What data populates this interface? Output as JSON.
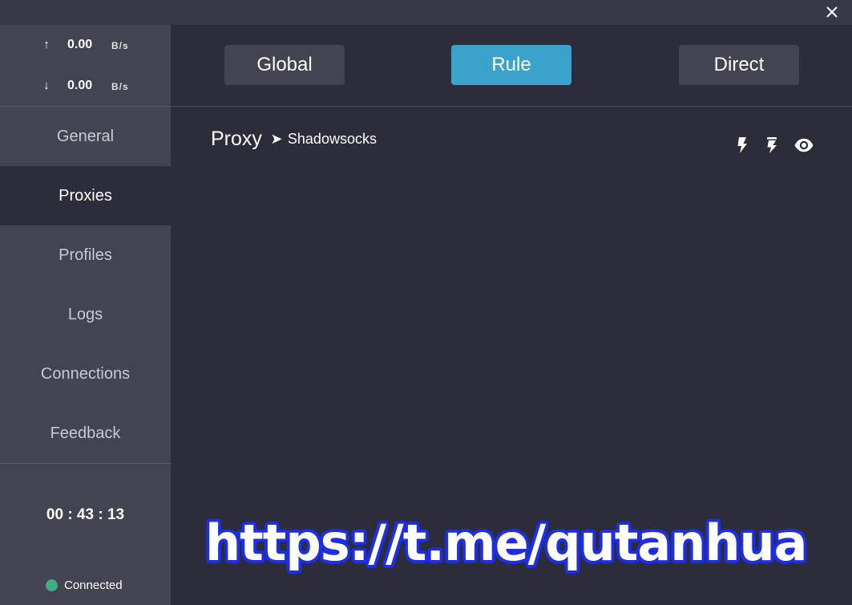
{
  "window": {
    "close_icon": "close-icon"
  },
  "traffic": {
    "upload": {
      "arrow": "↑",
      "value": "0.00",
      "unit": "B/s"
    },
    "download": {
      "arrow": "↓",
      "value": "0.00",
      "unit": "B/s"
    }
  },
  "sidebar": {
    "items": [
      {
        "label": "General"
      },
      {
        "label": "Proxies",
        "active": true
      },
      {
        "label": "Profiles"
      },
      {
        "label": "Logs"
      },
      {
        "label": "Connections"
      },
      {
        "label": "Feedback"
      }
    ],
    "timer": "00 : 43 : 13",
    "status": {
      "label": "Connected",
      "color": "#3fae80"
    }
  },
  "mode": {
    "options": [
      {
        "label": "Global"
      },
      {
        "label": "Rule",
        "active": true
      },
      {
        "label": "Direct"
      }
    ],
    "active_color": "#3ba2cc"
  },
  "proxies": {
    "group_name": "Proxy",
    "arrow": "➤",
    "selected": "Shadowsocks",
    "tools": [
      "lightning-icon",
      "lightning-list-icon",
      "eye-icon"
    ]
  },
  "watermark": {
    "text": "https://t.me/qutanhua",
    "color": "#1c2ee6"
  }
}
